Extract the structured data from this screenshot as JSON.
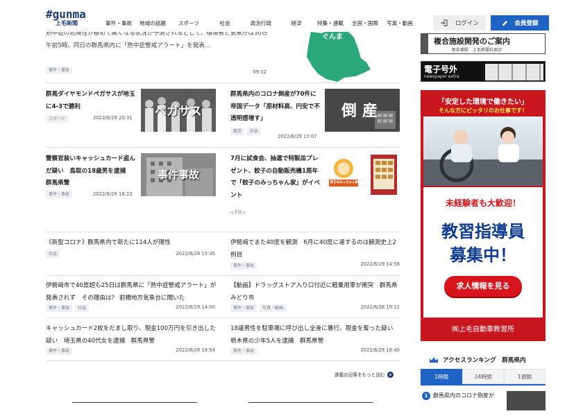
{
  "header": {
    "logo_main": "#gunma",
    "logo_sub": "上毛新聞",
    "nav": [
      "事件・事故",
      "地域の話題",
      "スポーツ",
      "社会",
      "政治行政",
      "経済",
      "特集・連載",
      "全国・国際",
      "写真・動画"
    ],
    "login_label": "ログイン",
    "register_label": "会員登録"
  },
  "top_article": {
    "text": "熱中症の危険性が極めて高くなる状況が予測されるとして、環境省と気象庁は30日午前5時、同日の群馬県内に「熱中症警戒アラート」を発表…",
    "tag": "事件・事故",
    "time": "09:02",
    "map_label": "ぐんま"
  },
  "image_articles": [
    {
      "title": "群馬ダイヤモンドペガサスが地玉に4-3で勝利",
      "tags": [
        "スポーツ"
      ],
      "date": "2022/6/29 20:31",
      "thumb_text": "ペガサス"
    },
    {
      "title": "群馬県内のコロナ倒産が70件に　帝国データ「原材料高、円安で不透明感増す」",
      "tags": [
        "経済",
        "社会"
      ],
      "date": "2022/6/29 17:07",
      "thumb_text": "倒産"
    },
    {
      "title": "警察官装いキャッシュカード盗んだ疑い　鳥取の18歳男を逮捕　群馬県警",
      "tags": [
        "事件・事故"
      ],
      "date": "2022/6/29 16:22",
      "thumb_text": "事件事故"
    },
    {
      "title": "7月に試食会、抽選で特製皿プレゼント、餃子の自動販売機1周年で「餃子のみっちゃん家」がイベント",
      "tags": [],
      "date": "",
      "pr": "<PR>",
      "thumb_text": "餃子のみっちゃん家"
    }
  ],
  "text_articles": [
    {
      "title": "《新型コロナ》群馬県内で新たに114人が陽性",
      "tags": [
        "社会"
      ],
      "date": "2022/6/29 15:45"
    },
    {
      "title": "伊勢崎でまた40度を観測　6月に40度に達するのは観測史上2例目",
      "tags": [
        "事件・事故"
      ],
      "date": "2022/6/29 14:56"
    },
    {
      "title": "伊勢崎市で40度超も25日は群馬県に「熱中症警戒アラート」が発表されず　その理由は？ 前橋地方気象台に聞いた",
      "tags": [
        "事件・事故",
        "社会"
      ],
      "date": "2022/6/29 14:00"
    },
    {
      "title": "【動画】ドラッグストア入り口付近に軽乗用車が衝突　群馬県みどり市",
      "tags": [
        "事件・事故",
        "写真・動画"
      ],
      "date": "2022/6/28 19:22"
    },
    {
      "title": "キャッシュカード2枚をだまし取り、現金100万円を引き出した疑い　埼玉県の40代女を逮捕　群馬県警",
      "tags": [
        "事件・事故"
      ],
      "date": "2022/6/28 18:54"
    },
    {
      "title": "18歳男性を駐車場に呼び出し全身に暴行、現金を奪った疑い　栃木県の少年5人を逮捕　群馬県警",
      "tags": [
        "事件・事故"
      ],
      "date": "2022/6/28 18:40"
    }
  ],
  "more_link": "連載の記事をもっと読む",
  "sidebar": {
    "banner1_text": "複合施設開発のご案内",
    "banner1_sub": "新前橋駅　上毛新聞社周辺",
    "banner2_title": "電子号外",
    "banner2_sub": "newspaper extra",
    "job_ad": {
      "top_line1": "「安定した環境で働きたい」",
      "top_line2": "そんな方にピッタリのお仕事です！",
      "welcome": "未経験者も大歓迎！",
      "headline1": "教習指導員",
      "headline2": "募集中！",
      "button": "求人情報を見る",
      "company": "㈱上毛自動車教習所"
    },
    "ranking": {
      "title": "アクセスランキング　群馬県内",
      "tabs": [
        "1時間",
        "24時間",
        "1週間"
      ],
      "items": [
        {
          "rank": "1",
          "title": "群馬県内のコロナ倒産が"
        }
      ]
    }
  },
  "colors": {
    "brand_blue": "#1f64c4",
    "logo_navy": "#1e3c78",
    "ad_red": "#c8161e",
    "map_green": "#2aa87a"
  }
}
